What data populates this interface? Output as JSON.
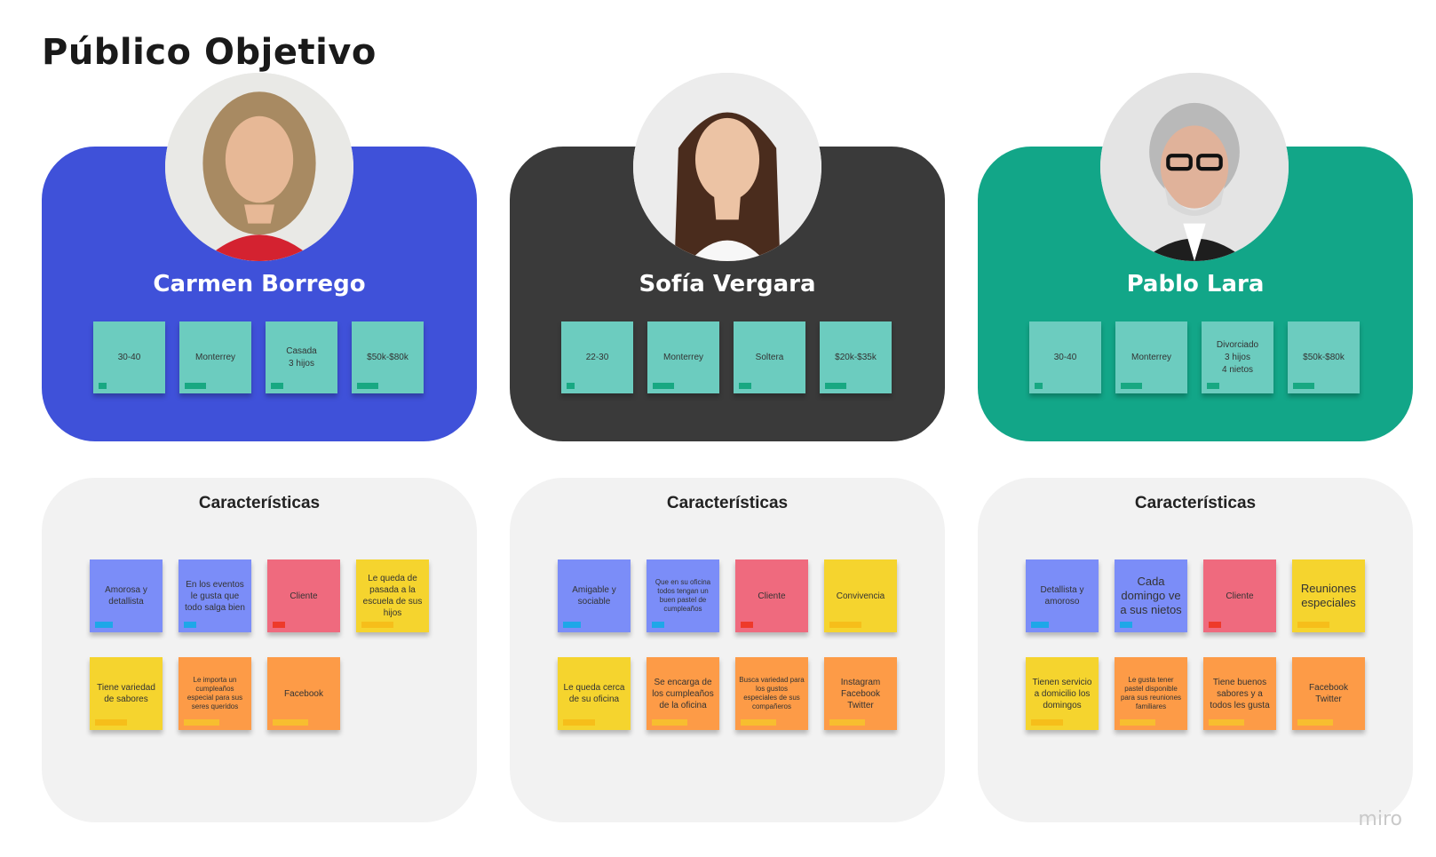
{
  "page": {
    "title": "Público Objetivo",
    "brand": "miro"
  },
  "colors": {
    "card_blue": "#3f51d9",
    "card_dark": "#3a3a3a",
    "card_green": "#12a688"
  },
  "personas": [
    {
      "name": "Carmen Borrego",
      "stats": [
        "30-40",
        "Monterrey",
        "Casada\n3 hijos",
        "$50k-$80k"
      ],
      "traits_title": "Características",
      "traits": [
        {
          "text": "Amorosa y detallista",
          "color": "blue"
        },
        {
          "text": "En los eventos le gusta que todo salga bien",
          "color": "blue"
        },
        {
          "text": "Cliente",
          "color": "red"
        },
        {
          "text": "Le queda de pasada a la escuela de sus hijos",
          "color": "yellow"
        },
        {
          "text": "Tiene variedad de sabores",
          "color": "yellow"
        },
        {
          "text": "Le importa un cumpleaños especial para sus seres queridos",
          "color": "orange"
        },
        {
          "text": "Facebook",
          "color": "orange"
        }
      ]
    },
    {
      "name": "Sofía Vergara",
      "stats": [
        "22-30",
        "Monterrey",
        "Soltera",
        "$20k-$35k"
      ],
      "traits_title": "Características",
      "traits": [
        {
          "text": "Amigable y sociable",
          "color": "blue"
        },
        {
          "text": "Que en su oficina todos tengan un buen pastel de cumpleaños",
          "color": "blue"
        },
        {
          "text": "Cliente",
          "color": "red"
        },
        {
          "text": "Convivencia",
          "color": "yellow"
        },
        {
          "text": "Le queda cerca de su oficina",
          "color": "yellow"
        },
        {
          "text": "Se encarga de los cumpleaños de la oficina",
          "color": "orange"
        },
        {
          "text": "Busca variedad para los gustos especiales de sus compañeros",
          "color": "orange"
        },
        {
          "text": "Instagram\nFacebook\nTwitter",
          "color": "orange"
        }
      ]
    },
    {
      "name": "Pablo Lara",
      "stats": [
        "30-40",
        "Monterrey",
        "Divorciado\n3 hijos\n4 nietos",
        "$50k-$80k"
      ],
      "traits_title": "Características",
      "traits": [
        {
          "text": "Detallista y amoroso",
          "color": "blue"
        },
        {
          "text": "Cada domingo ve a sus nietos",
          "color": "blue"
        },
        {
          "text": "Cliente",
          "color": "red"
        },
        {
          "text": "Reuniones especiales",
          "color": "yellow"
        },
        {
          "text": "Tienen servicio a domicilio los domingos",
          "color": "yellow"
        },
        {
          "text": "Le gusta tener pastel disponible para sus reuniones familiares",
          "color": "orange"
        },
        {
          "text": "Tiene buenos sabores y a todos les gusta",
          "color": "orange"
        },
        {
          "text": "Facebook\nTwitter",
          "color": "orange"
        }
      ]
    }
  ]
}
